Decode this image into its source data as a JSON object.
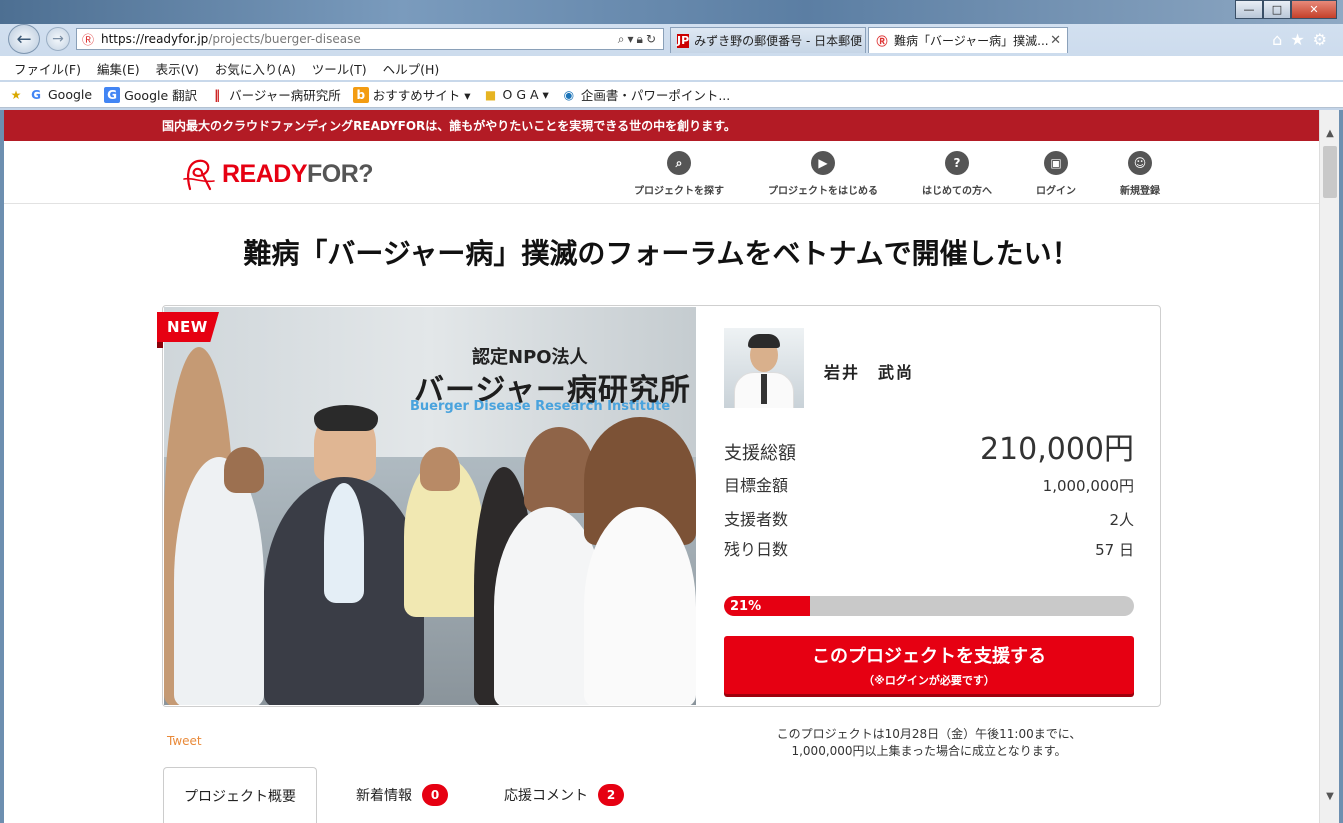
{
  "browser": {
    "url_host": "https://readyfor.jp",
    "url_path": "/projects/buerger-disease",
    "tabs": [
      {
        "label": "みずき野の郵便番号 - 日本郵便",
        "active": false
      },
      {
        "label": "難病「バージャー病」撲滅...",
        "active": true
      }
    ],
    "menu": [
      "ファイル(F)",
      "編集(E)",
      "表示(V)",
      "お気に入り(A)",
      "ツール(T)",
      "ヘルプ(H)"
    ],
    "favorites": [
      "Google",
      "Google 翻訳",
      "バージャー病研究所",
      "おすすめサイト ▾",
      "O G A ▾",
      "企画書・パワーポイント..."
    ]
  },
  "site": {
    "banner": "国内最大のクラウドファンディングREADYFORは、誰もがやりたいことを実現できる世の中を創ります。",
    "logo_ready": "READY",
    "logo_for": "FOR?",
    "nav": [
      {
        "label": "プロジェクトを探す",
        "icon": "search-icon"
      },
      {
        "label": "プロジェクトをはじめる",
        "icon": "play-icon"
      },
      {
        "label": "はじめての方へ",
        "icon": "question-icon"
      },
      {
        "label": "ログイン",
        "icon": "lock-icon"
      },
      {
        "label": "新規登録",
        "icon": "user-icon"
      }
    ]
  },
  "project": {
    "title": "難病「バージャー病」撲滅のフォーラムをベトナムで開催したい！",
    "new_badge": "NEW",
    "photo_sign": {
      "line1": "認定NPO法人",
      "line2": "バージャー病研究所",
      "line3": "Buerger Disease Research Institute"
    },
    "owner": "岩井　武尚",
    "stats": {
      "total_label": "支援総額",
      "total_value": "210,000円",
      "goal_label": "目標金額",
      "goal_value": "1,000,000円",
      "backers_label": "支援者数",
      "backers_value": "2人",
      "days_label": "残り日数",
      "days_value": "57 日"
    },
    "progress_text": "21%",
    "progress_fraction": 0.21,
    "support_button": "このプロジェクトを支援する",
    "support_note": "（※ログインが必要です）",
    "tweet": "Tweet",
    "notice_line1": "このプロジェクトは10月28日（金）午後11:00までに、",
    "notice_line2": "1,000,000円以上集まった場合に成立となります。",
    "tabs": [
      {
        "label": "プロジェクト概要"
      },
      {
        "label": "新着情報",
        "count": "0"
      },
      {
        "label": "応援コメント",
        "count": "2"
      }
    ]
  },
  "colors": {
    "brand_red": "#e60012",
    "banner_red": "#b31b25"
  }
}
